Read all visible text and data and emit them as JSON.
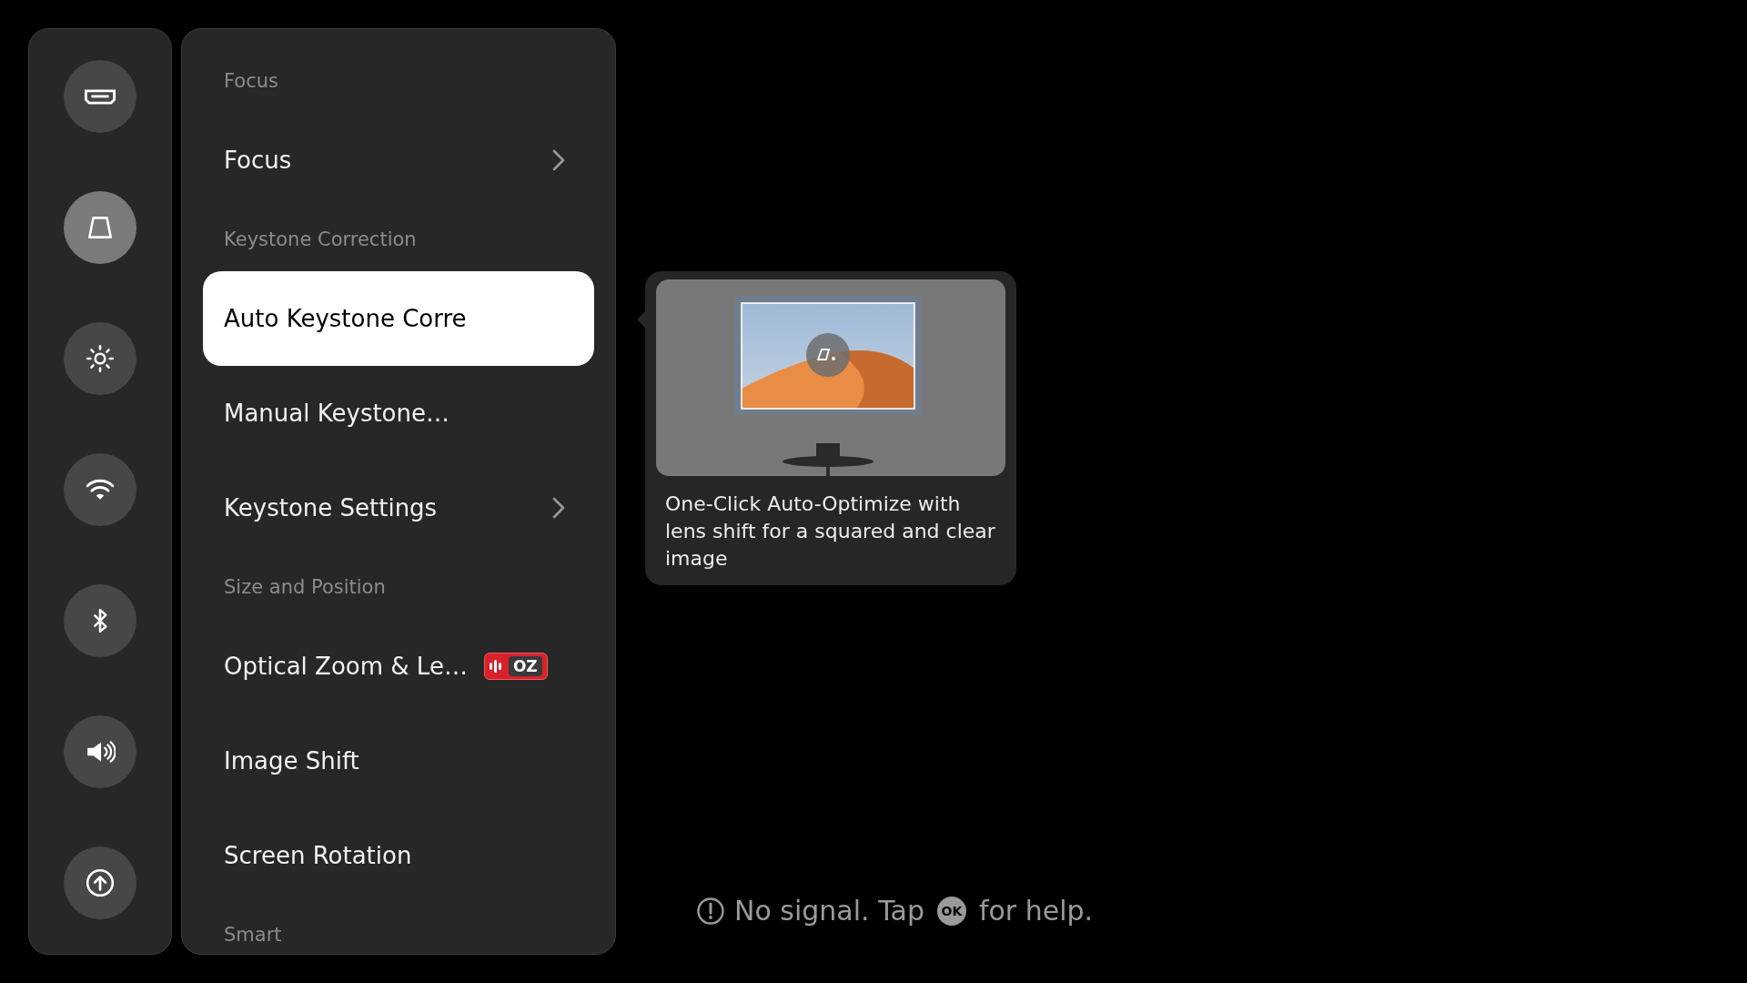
{
  "sidebar": {
    "items": [
      {
        "selected": false
      },
      {
        "selected": true
      },
      {
        "selected": false
      },
      {
        "selected": false
      },
      {
        "selected": false
      },
      {
        "selected": false
      },
      {
        "selected": false
      }
    ]
  },
  "menu": {
    "entries": [
      {
        "kind": "header",
        "label": "Focus"
      },
      {
        "kind": "item",
        "label": "Focus",
        "selected": false,
        "chevron": true
      },
      {
        "kind": "header",
        "label": "Keystone Correction"
      },
      {
        "kind": "item",
        "label": "Auto Keystone Corre",
        "selected": true,
        "chevron": false
      },
      {
        "kind": "item",
        "label": "Manual Keystone…",
        "selected": false,
        "chevron": false
      },
      {
        "kind": "item",
        "label": "Keystone Settings",
        "selected": false,
        "chevron": true
      },
      {
        "kind": "header",
        "label": "Size and Position"
      },
      {
        "kind": "item",
        "label": "Optical Zoom & Le…",
        "selected": false,
        "chevron": false,
        "badge": "OZ"
      },
      {
        "kind": "item",
        "label": "Image Shift",
        "selected": false,
        "chevron": false
      },
      {
        "kind": "item",
        "label": "Screen Rotation",
        "selected": false,
        "chevron": false
      },
      {
        "kind": "header",
        "label": "Smart"
      }
    ]
  },
  "tooltip": {
    "text": "One-Click Auto-Optimize with lens shift for a squared and clear image"
  },
  "status": {
    "before": "No signal. Tap",
    "key": "OK",
    "after": "for help."
  }
}
